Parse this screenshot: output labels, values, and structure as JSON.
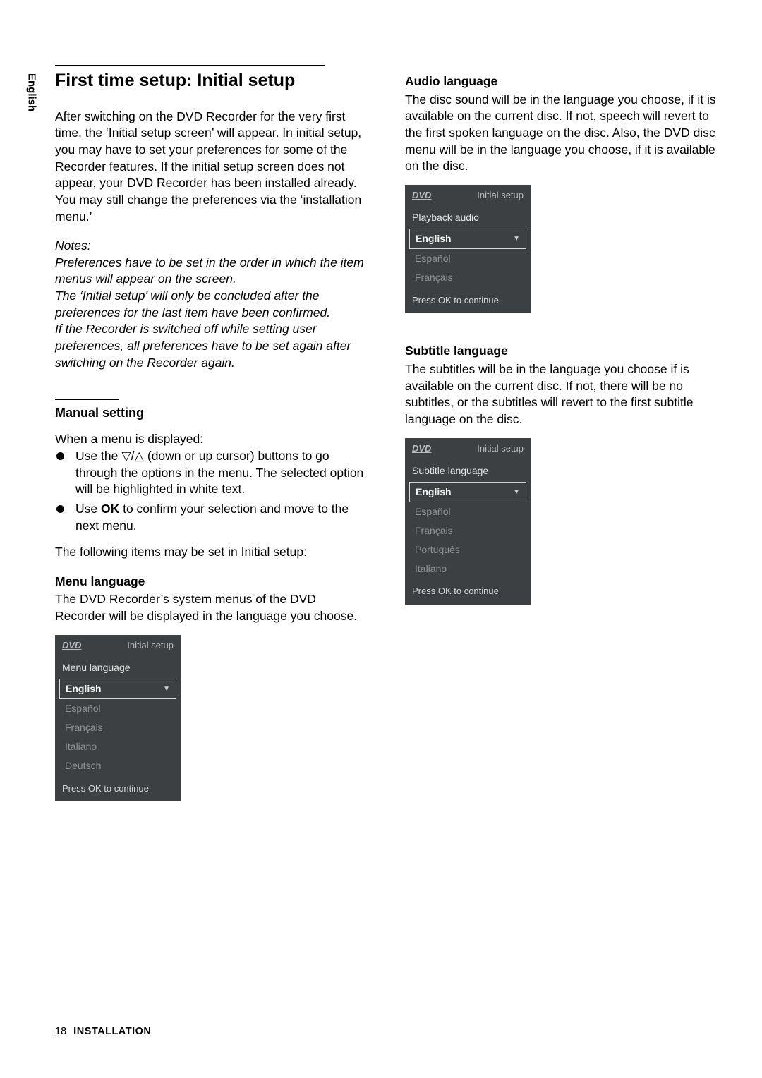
{
  "lang_tab": "English",
  "title": "First time setup: Initial setup",
  "intro": "After switching on the DVD Recorder for the very first time, the ‘Initial setup screen’ will appear. In initial setup, you may have to set your preferences for some of the Recorder features. If the initial setup screen does not appear, your DVD Recorder has been installed already. You may still change the preferences via the ‘installation menu.’",
  "notes_head": "Notes:",
  "notes1": "Preferences have to be set in the order in which the item menus will appear on the screen.",
  "notes2": "The ‘Initial setup’ will only be concluded after the preferences for the last item have been confirmed.",
  "notes3": "If the Recorder is switched off while setting user preferences, all preferences have to be set again after switching on the Recorder again.",
  "manual_heading": "Manual setting",
  "manual_intro": "When a menu is displayed:",
  "bullet1a": "Use the ",
  "bullet1b": " (down or up cursor) buttons to go through the options in the menu. The selected option will be highlighted in white text.",
  "bullet2a": "Use ",
  "bullet2b": "OK",
  "bullet2c": " to confirm your selection and move to the next menu.",
  "following_line": "The following items may be set in Initial setup:",
  "menu_lang_head": "Menu language",
  "menu_lang_body": "The DVD Recorder’s system menus of the DVD Recorder will be displayed in the language you choose.",
  "audio_lang_head": "Audio language",
  "audio_lang_body": "The disc sound will be in the language you choose, if it is available on the current disc. If not, speech will revert to the first spoken language on the disc. Also, the DVD disc menu will be in the language you choose, if it is available on the disc.",
  "subtitle_lang_head": "Subtitle language",
  "subtitle_lang_body": "The subtitles will be in the language you choose if is available on the current disc. If not, there will be no subtitles, or the subtitles will revert to the first subtitle language on the disc.",
  "osd_common": {
    "dvd": "DVD",
    "initial": "Initial setup",
    "press_ok": "Press OK to continue"
  },
  "osd1": {
    "sub": "Menu language",
    "opts": [
      "English",
      "Español",
      "Français",
      "Italiano",
      "Deutsch"
    ]
  },
  "osd2": {
    "sub": "Playback audio",
    "opts": [
      "English",
      "Español",
      "Français"
    ]
  },
  "osd3": {
    "sub": "Subtitle language",
    "opts": [
      "English",
      "Español",
      "Français",
      "Português",
      "Italiano"
    ]
  },
  "footer": {
    "page": "18",
    "section": "INSTALLATION"
  }
}
